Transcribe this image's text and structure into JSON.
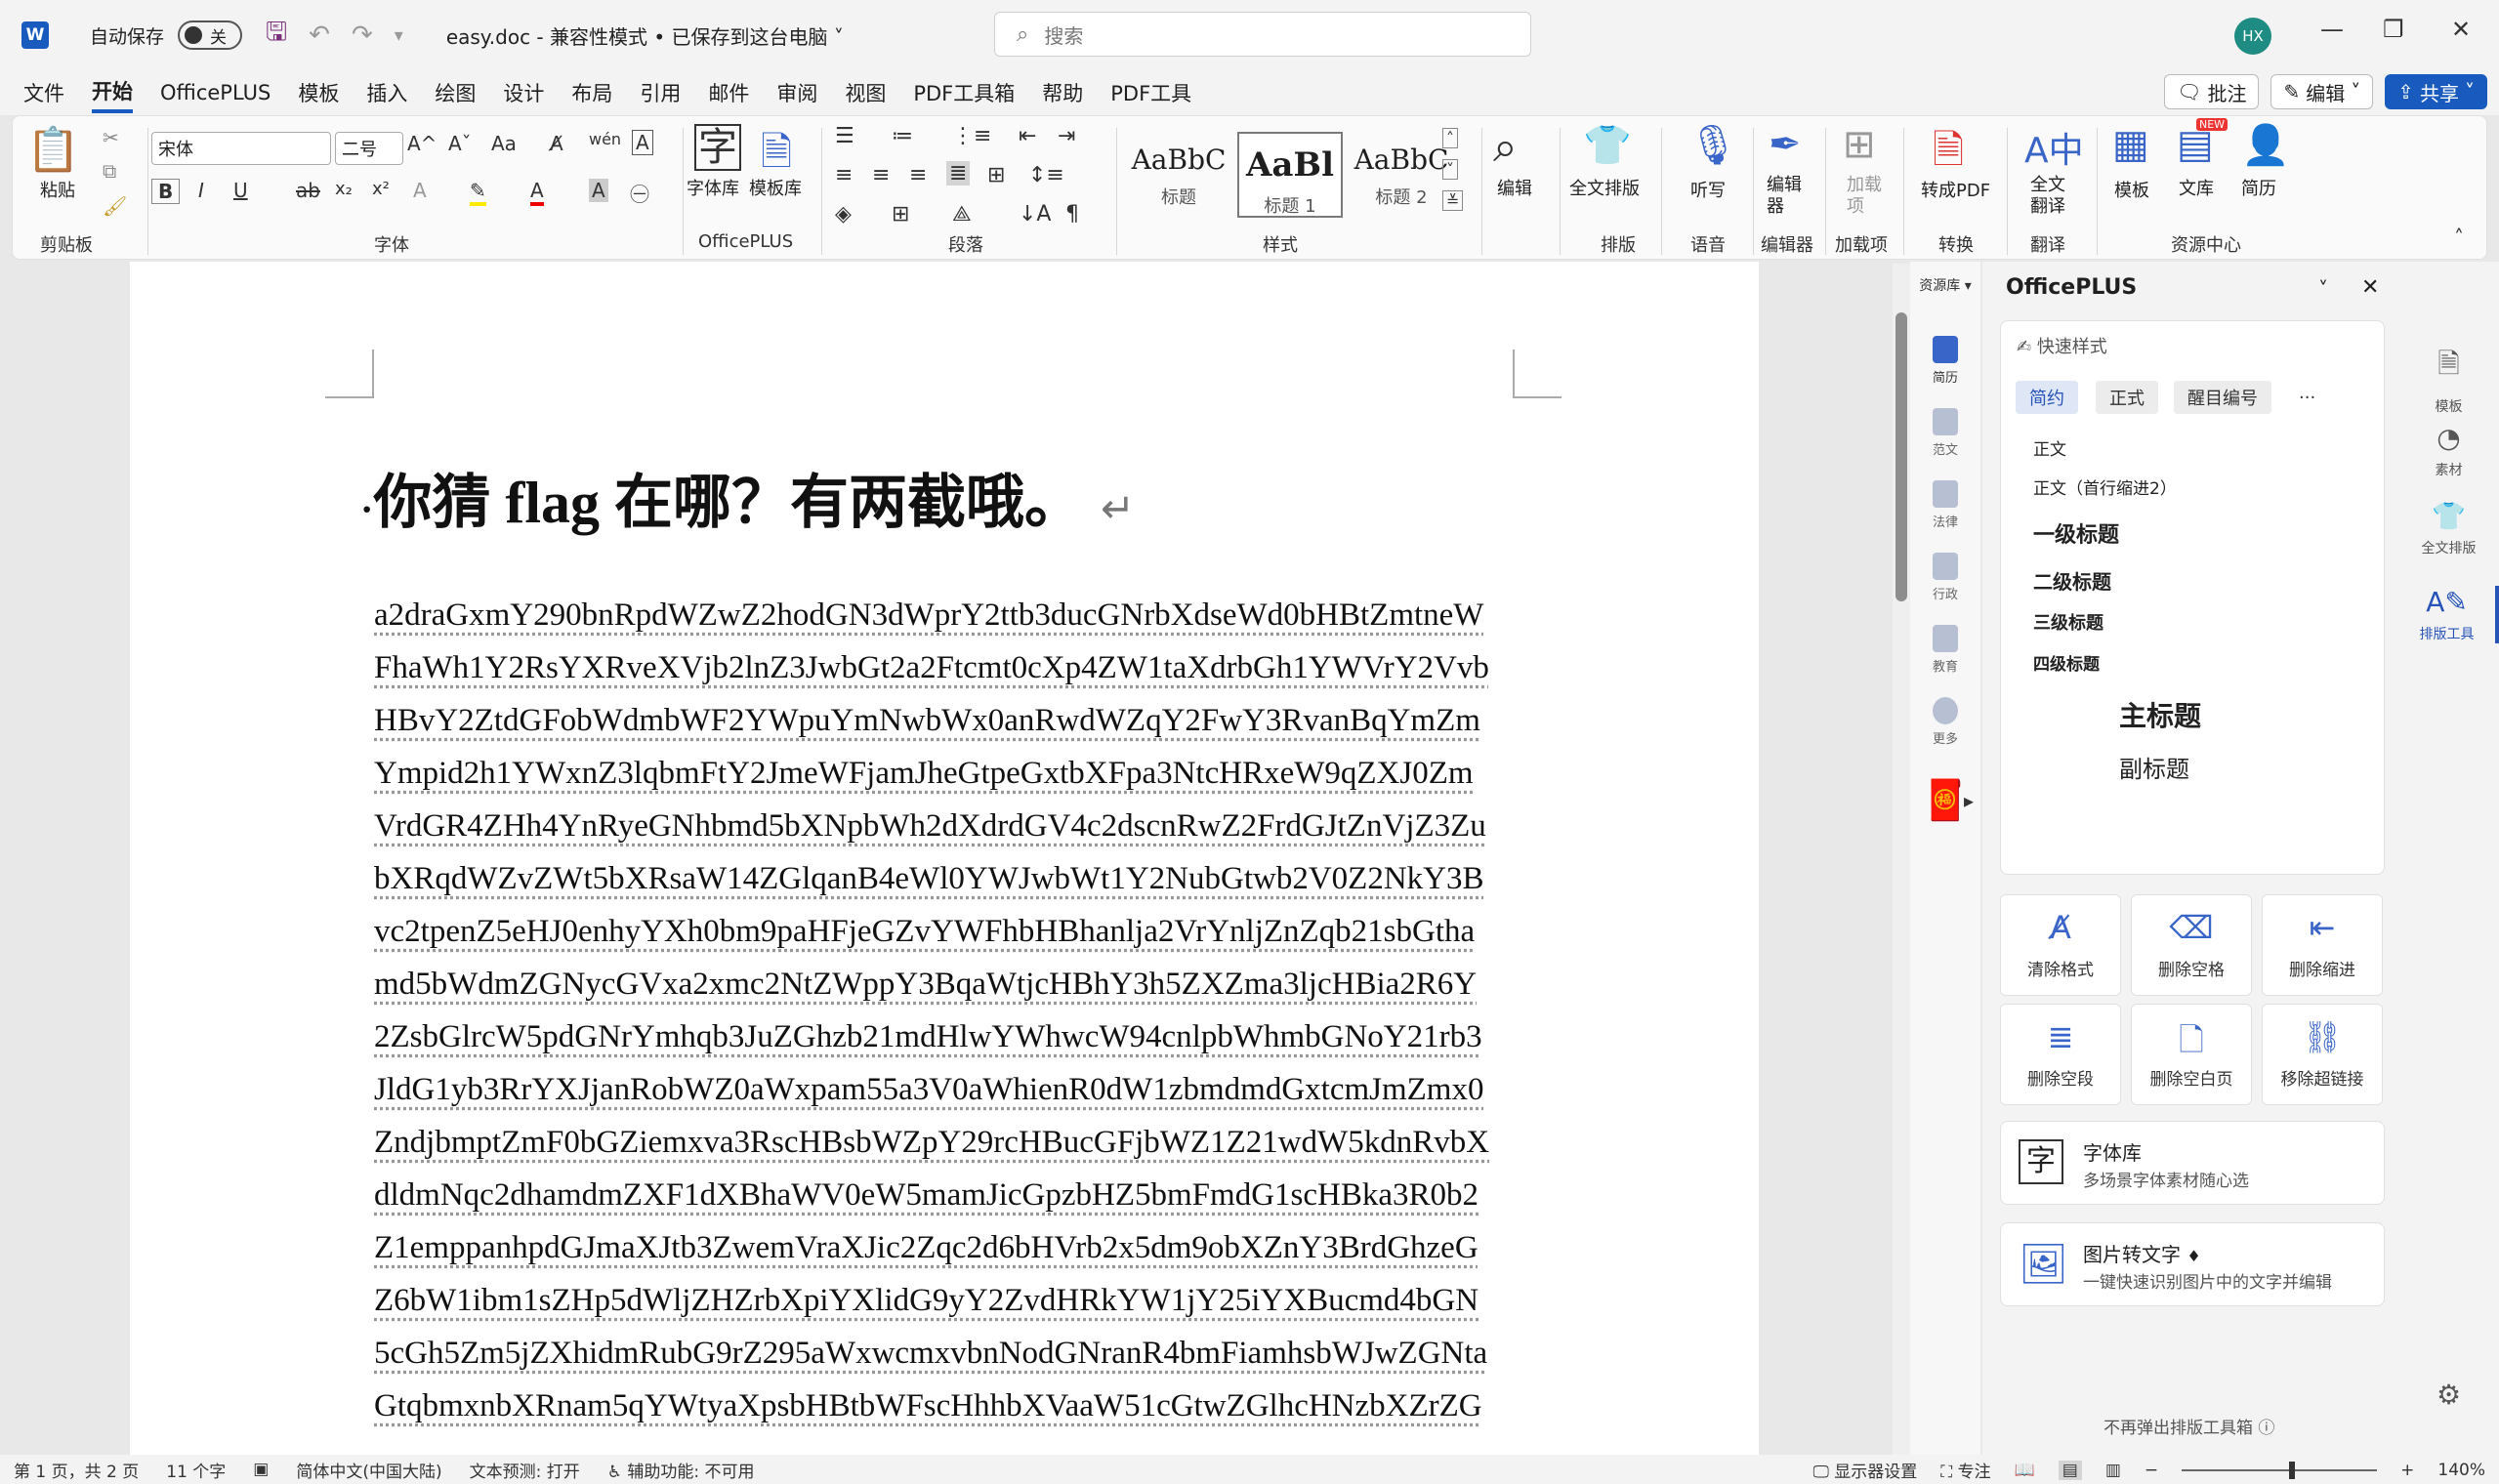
{
  "titlebar": {
    "autosave_label": "自动保存",
    "autosave_state": "关",
    "doc_title": "easy.doc  -  兼容性模式 • 已保存到这台电脑 ˅",
    "search_placeholder": "搜索",
    "avatar_initials": "HX"
  },
  "menu": {
    "tabs": [
      "文件",
      "开始",
      "OfficePLUS",
      "模板",
      "插入",
      "绘图",
      "设计",
      "布局",
      "引用",
      "邮件",
      "审阅",
      "视图",
      "PDF工具箱",
      "帮助",
      "PDF工具"
    ],
    "comment_label": "批注",
    "edit_label": "编辑",
    "share_label": "共享"
  },
  "ribbon": {
    "paste_label": "粘贴",
    "clipboard_group": "剪贴板",
    "font_name": "宋体",
    "font_size": "二号",
    "font_group": "字体",
    "officeplus_group": "OfficePLUS",
    "fontlib_label": "字体库",
    "templatelib_label": "模板库",
    "paragraph_group": "段落",
    "styles_group": "样式",
    "styles": [
      {
        "preview": "AaBbC",
        "name": "标题"
      },
      {
        "preview": "AaBl",
        "name": "标题 1"
      },
      {
        "preview": "AaBbC",
        "name": "标题 2"
      }
    ],
    "edit_label": "编辑",
    "typeset_label": "全文排版",
    "typeset_group": "排版",
    "dictate_label": "听写",
    "voice_group": "语音",
    "editor_label": "编辑器",
    "editor_group": "编辑器",
    "addin_label": "加载项",
    "addin_group": "加载项",
    "topdf_label": "转成PDF",
    "convert_group": "转换",
    "translate_label": "全文翻译",
    "translate_group": "翻译",
    "template_label": "模板",
    "library_label": "文库",
    "library_badge": "NEW",
    "resume_label": "简历",
    "resource_group": "资源中心"
  },
  "document": {
    "heading": "你猜 flag 在哪？有两截哦。",
    "lines": [
      "a2draGxmY290bnRpdWZwZ2hodGN3dWprY2ttb3ducGNrbXdseWd0bHBtZmtneW",
      "FhaWh1Y2RsYXRveXVjb2lnZ3JwbGt2a2Ftcmt0cXp4ZW1taXdrbGh1YWVrY2Vvb",
      "HBvY2ZtdGFobWdmbWF2YWpuYmNwbWx0anRwdWZqY2FwY3RvanBqYmZm",
      "Ympid2h1YWxnZ3lqbmFtY2JmeWFjamJheGtpeGxtbXFpa3NtcHRxeW9qZXJ0Zm",
      "VrdGR4ZHh4YnRyeGNhbmd5bXNpbWh2dXdrdGV4c2dscnRwZ2FrdGJtZnVjZ3Zu",
      "bXRqdWZvZWt5bXRsaW14ZGlqanB4eWl0YWJwbWt1Y2NubGtwb2V0Z2NkY3B",
      "vc2tpenZ5eHJ0enhyYXh0bm9paHFjeGZvYWFhbHBhanlja2VrYnljZnZqb21sbGtha",
      "md5bWdmZGNycGVxa2xmc2NtZWppY3BqaWtjcHBhY3h5ZXZma3ljcHBia2R6Y",
      "2ZsbGlrcW5pdGNrYmhqb3JuZGhzb21mdHlwYWhwcW94cnlpbWhmbGNoY21rb3",
      "JldG1yb3RrYXJjanRobWZ0aWxpam55a3V0aWhienR0dW1zbmdmdGxtcmJmZmx0",
      "ZndjbmptZmF0bGZiemxva3RscHBsbWZpY29rcHBucGFjbWZ1Z21wdW5kdnRvbX",
      "dldmNqc2dhamdmZXF1dXBhaWV0eW5mamJicGpzbHZ5bmFmdG1scHBka3R0b2",
      "Z1emppanhpdGJmaXJtb3ZwemVraXJic2Zqc2d6bHVrb2x5dm9obXZnY3BrdGhzeG",
      "Z6bW1ibm1sZHp5dWljZHZrbXpiYXlidG9yY2ZvdHRkYW1jY25iYXBucmd4bGN",
      "5cGh5Zm5jZXhidmRubG9rZ295aWxwcmxvbnNodGNranR4bmFiamhsbWJwZGNta",
      "GtqbmxnbXRnam5qYWtyaXpsbHBtbWFscHhhbXVaaW51cGtwZGlhcHNzbXZrZG"
    ]
  },
  "resource_col": {
    "header": "资源库",
    "items": [
      "简历",
      "范文",
      "法律",
      "行政",
      "教育",
      "更多"
    ]
  },
  "panel": {
    "title": "OfficePLUS",
    "quick_style": "快速样式",
    "chips": [
      "简约",
      "正式",
      "醒目编号",
      "···"
    ],
    "styles": [
      "正文",
      "正文（首行缩进2）",
      "一级标题",
      "二级标题",
      "三级标题",
      "四级标题",
      "主标题",
      "副标题"
    ],
    "tools": [
      "清除格式",
      "删除空格",
      "删除缩进",
      "删除空段",
      "删除空白页",
      "移除超链接"
    ],
    "fontlib_title": "字体库",
    "fontlib_desc": "多场景字体素材随心选",
    "ocr_title": "图片转文字",
    "ocr_desc": "一键快速识别图片中的文字并编辑",
    "footer": "不再弹出排版工具箱"
  },
  "right_strip": {
    "items": [
      "模板",
      "素材",
      "全文排版",
      "排版工具"
    ]
  },
  "statusbar": {
    "page": "第 1 页，共 2 页",
    "words": "11 个字",
    "language": "简体中文(中国大陆)",
    "prediction": "文本预测: 打开",
    "accessibility": "辅助功能: 不可用",
    "display": "显示器设置",
    "focus": "专注",
    "zoom": "140%"
  },
  "colors": {
    "accent": "#185abd",
    "panel_accent": "#2753b8"
  }
}
